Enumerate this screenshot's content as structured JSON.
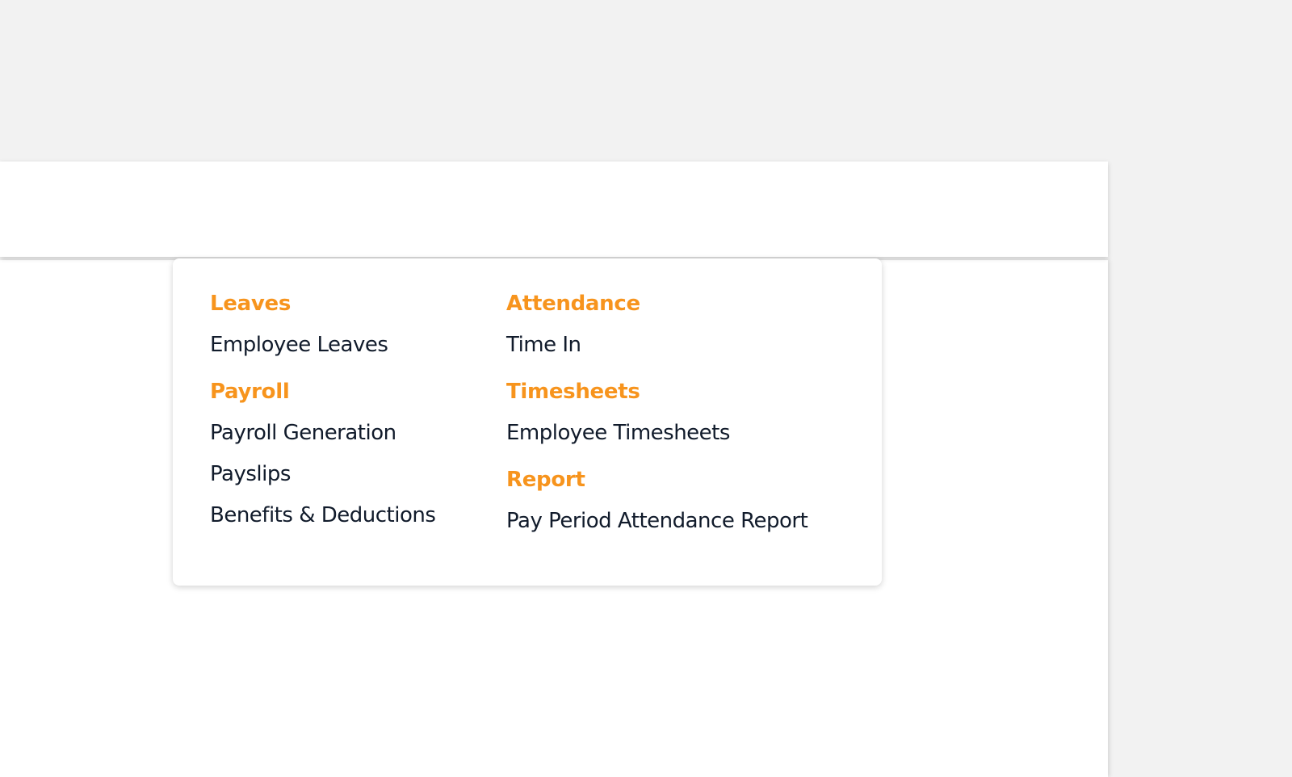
{
  "colors": {
    "accent": "#f7941d",
    "text": "#111b2b",
    "background": "#f2f2f2",
    "surface": "#ffffff"
  },
  "header": {
    "icons": [
      {
        "name": "home-icon",
        "state": "inactive"
      },
      {
        "name": "team-icon",
        "state": "active",
        "caret": "caret-up-icon"
      },
      {
        "name": "user-icon",
        "state": "inactive",
        "caret": "caret-down-icon"
      }
    ]
  },
  "dropdown": {
    "columns": [
      {
        "groups": [
          {
            "title": "Leaves",
            "items": [
              "Employee Leaves"
            ]
          },
          {
            "title": "Payroll",
            "items": [
              "Payroll Generation",
              "Payslips",
              "Benefits & Deductions"
            ]
          }
        ]
      },
      {
        "groups": [
          {
            "title": "Attendance",
            "items": [
              "Time In"
            ]
          },
          {
            "title": "Timesheets",
            "items": [
              "Employee Timesheets"
            ]
          },
          {
            "title": "Report",
            "items": [
              "Pay Period Attendance Report"
            ]
          }
        ]
      }
    ]
  }
}
